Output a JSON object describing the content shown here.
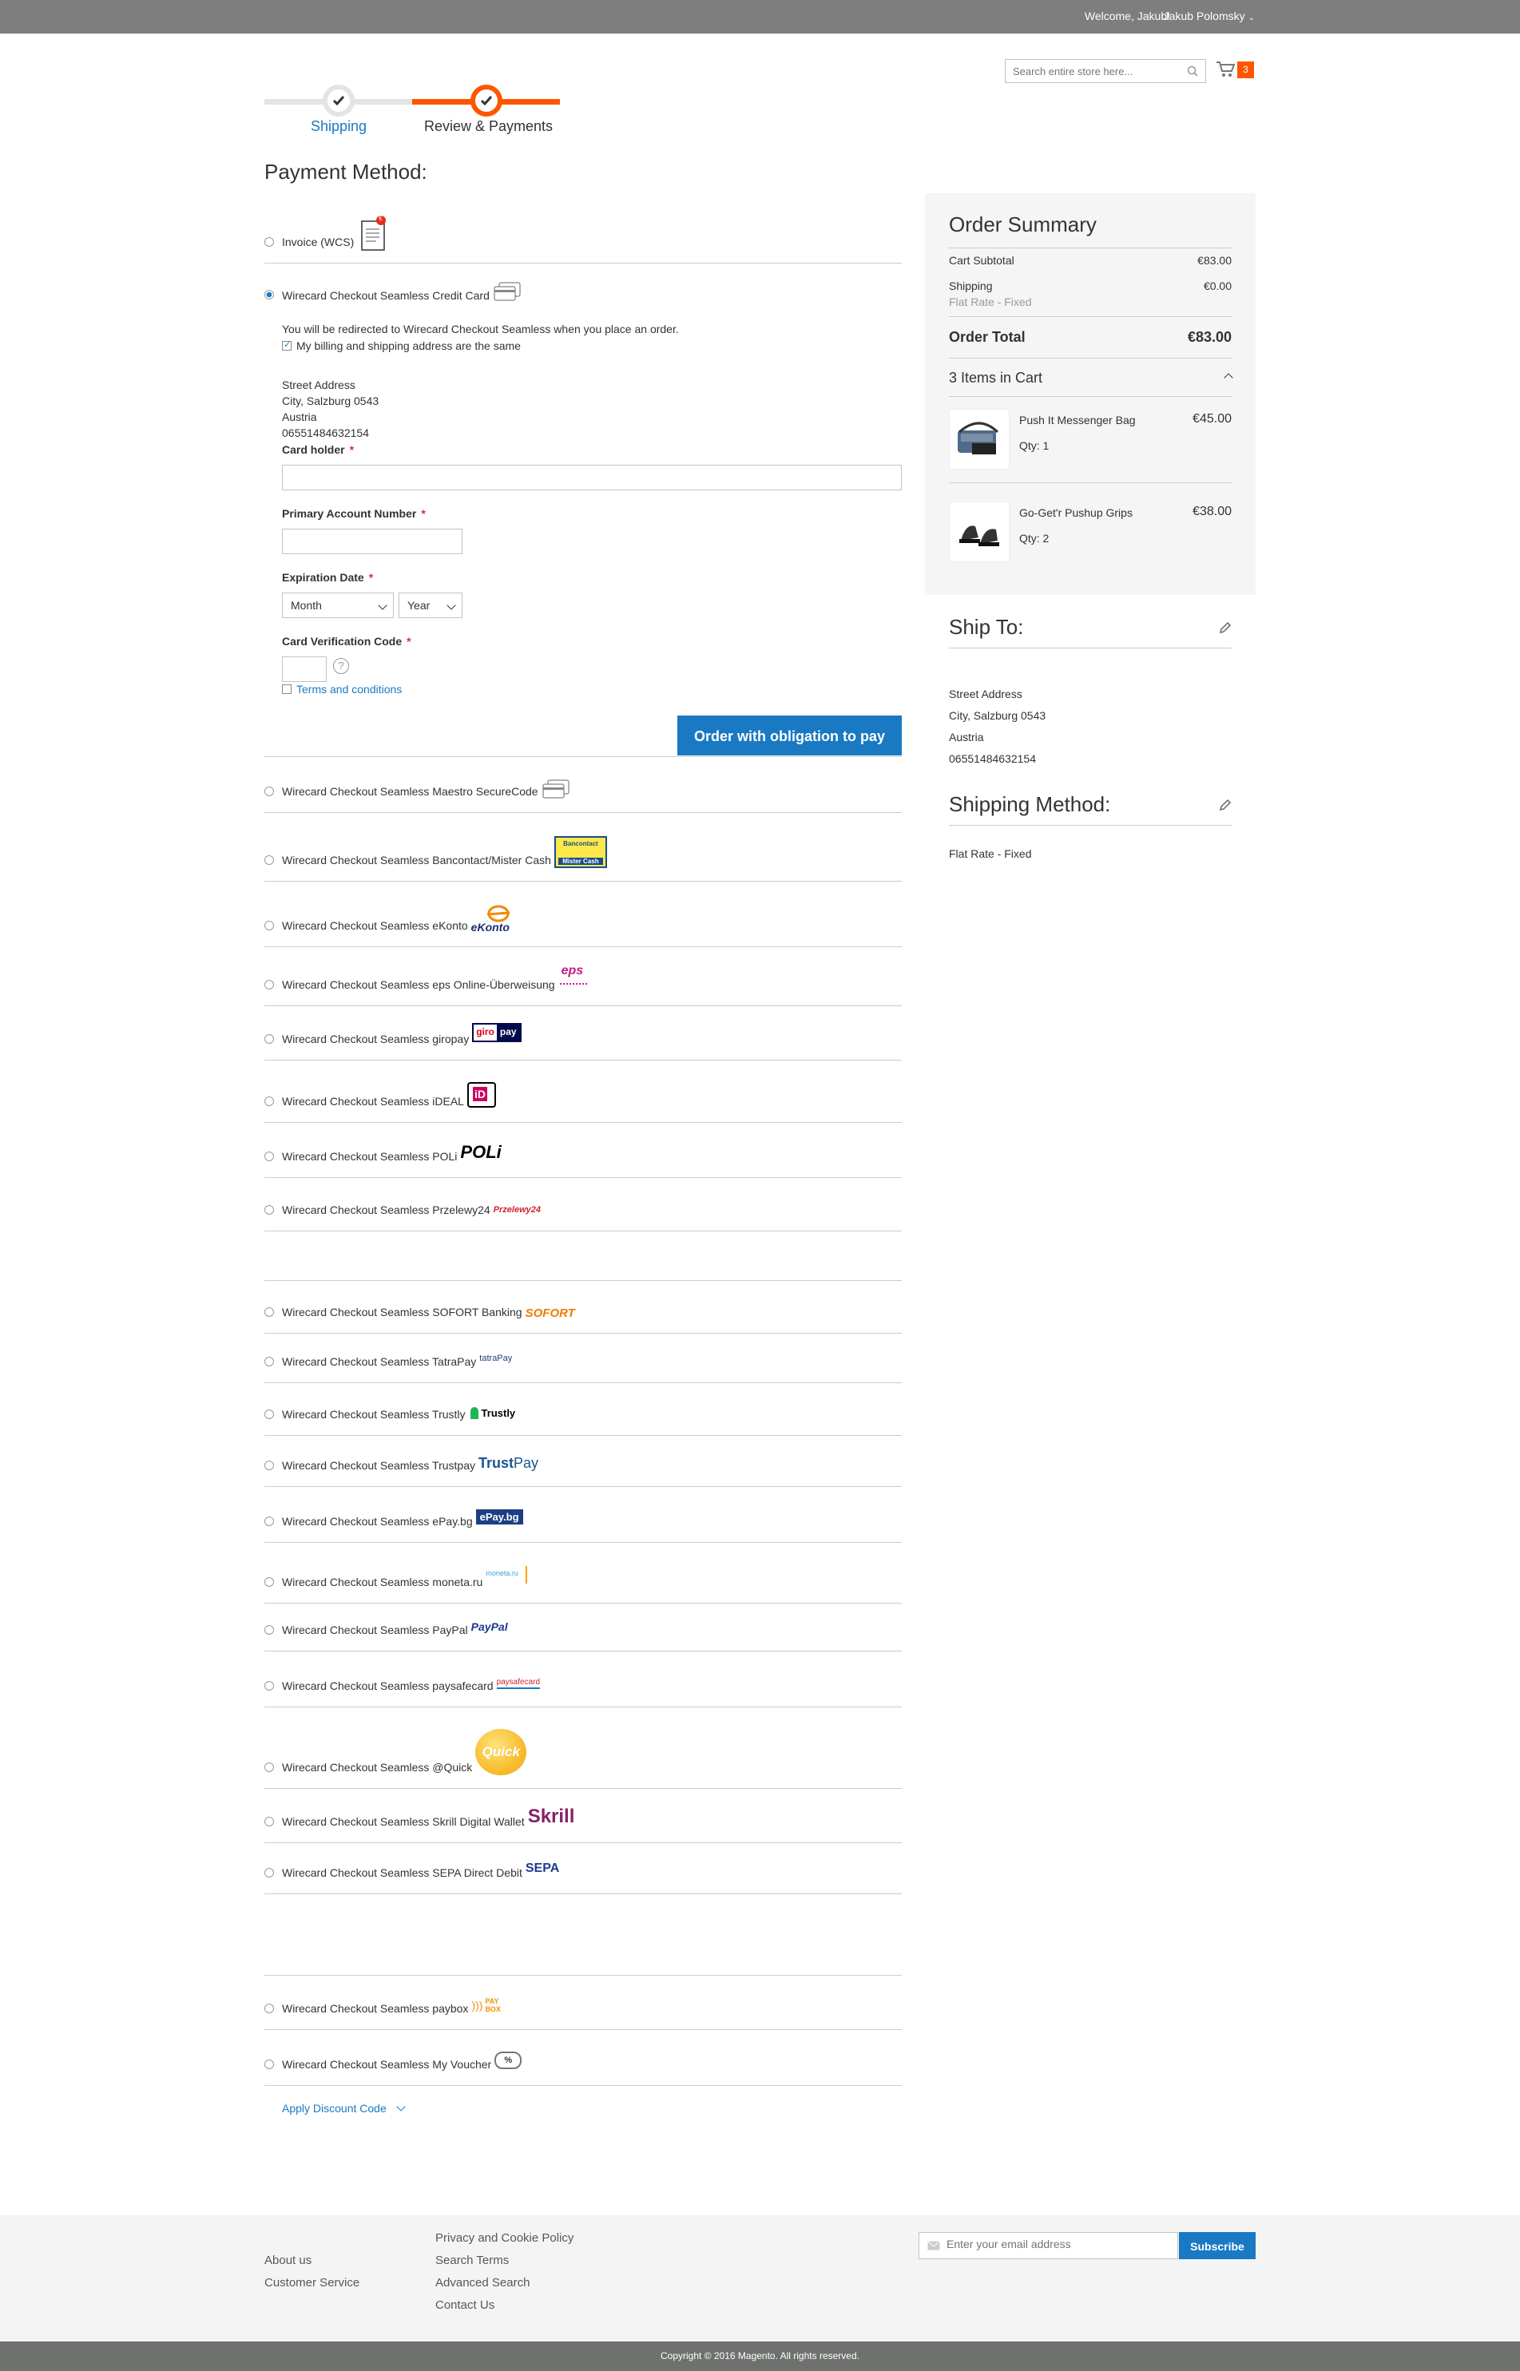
{
  "header": {
    "welcome": "Welcome, Jakub!",
    "user_name": "Jakub Polomsky",
    "search_placeholder": "Search entire store here...",
    "cart_count": "3"
  },
  "progress": {
    "step1": "Shipping",
    "step2": "Review & Payments"
  },
  "payment": {
    "title": "Payment Method:",
    "invoice_label": "Invoice (WCS)",
    "invoice_badge": "€",
    "cc_label": "Wirecard Checkout Seamless Credit Card",
    "redirect_text": "You will be redirected to Wirecard Checkout Seamless when you place an order.",
    "same_address_label": "My billing and shipping address are the same",
    "address": [
      "Street Address",
      "City, Salzburg 0543",
      "Austria",
      "06551484632154"
    ],
    "card_holder_label": "Card holder",
    "pan_label": "Primary Account Number",
    "expiration_label": "Expiration Date",
    "month_selected": "Month",
    "year_selected": "Year",
    "cvc_label": "Card Verification Code",
    "cvc_help": "?",
    "terms_label": "Terms and conditions",
    "order_button": "Order with obligation to pay",
    "discount_label": "Apply Discount Code",
    "methods": [
      {
        "label": "Wirecard Checkout Seamless Maestro SecureCode",
        "logo": "card-icon"
      },
      {
        "label": "Wirecard Checkout Seamless Bancontact/Mister Cash",
        "logo": "bancontact-logo",
        "logo_text_1": "Bancontact",
        "logo_text_2": "Mister Cash"
      },
      {
        "label": "Wirecard Checkout Seamless eKonto",
        "logo": "ekonto-logo",
        "logo_text": "eKonto"
      },
      {
        "label": "Wirecard Checkout Seamless eps Online-Überweisung",
        "logo": "eps-logo",
        "logo_text": "eps"
      },
      {
        "label": "Wirecard Checkout Seamless giropay",
        "logo": "giropay-logo",
        "logo_text_1": "giro",
        "logo_text_2": "pay"
      },
      {
        "label": "Wirecard Checkout Seamless iDEAL",
        "logo": "ideal-logo",
        "logo_text": "iD"
      },
      {
        "label": "Wirecard Checkout Seamless POLi",
        "logo": "poli-logo",
        "logo_text": "POLi"
      },
      {
        "label": "Wirecard Checkout Seamless Przelewy24",
        "logo": "przelewy24-logo",
        "logo_text": "Przelewy24"
      },
      {
        "label": "",
        "logo": ""
      },
      {
        "label": "Wirecard Checkout Seamless SOFORT Banking",
        "logo": "sofort-logo",
        "logo_text": "SOFORT"
      },
      {
        "label": "Wirecard Checkout Seamless TatraPay",
        "logo": "tatrapay-logo",
        "logo_text": "tatraPay"
      },
      {
        "label": "Wirecard Checkout Seamless Trustly",
        "logo": "trustly-logo",
        "logo_text": "Trustly"
      },
      {
        "label": "Wirecard Checkout Seamless Trustpay",
        "logo": "trustpay-logo",
        "logo_text_1": "Trust",
        "logo_text_2": "Pay"
      },
      {
        "label": "Wirecard Checkout Seamless ePay.bg",
        "logo": "epaybg-logo",
        "logo_text": "ePay.bg"
      },
      {
        "label": "Wirecard Checkout Seamless moneta.ru",
        "logo": "moneta-logo",
        "logo_text": "moneta.ru"
      },
      {
        "label": "Wirecard Checkout Seamless PayPal",
        "logo": "paypal-logo",
        "logo_text": "PayPal"
      },
      {
        "label": "Wirecard Checkout Seamless paysafecard",
        "logo": "paysafecard-logo",
        "logo_text": "paysafecard"
      },
      {
        "label": "Wirecard Checkout Seamless @Quick",
        "logo": "quick-logo",
        "logo_text": "Quick"
      },
      {
        "label": "Wirecard Checkout Seamless Skrill Digital Wallet",
        "logo": "skrill-logo",
        "logo_text": "Skrill"
      },
      {
        "label": "Wirecard Checkout Seamless SEPA Direct Debit",
        "logo": "sepa-logo",
        "logo_text": "SEPA"
      },
      {
        "label": "",
        "logo": ""
      },
      {
        "label": "Wirecard Checkout Seamless paybox",
        "logo": "paybox-logo",
        "logo_text_1": "PAY",
        "logo_text_2": "BOX"
      },
      {
        "label": "Wirecard Checkout Seamless My Voucher",
        "logo": "voucher-logo",
        "logo_text": "%"
      }
    ]
  },
  "summary": {
    "title": "Order Summary",
    "cart_subtotal_label": "Cart Subtotal",
    "cart_subtotal": "€83.00",
    "shipping_label": "Shipping",
    "shipping_value": "€0.00",
    "shipping_method": "Flat Rate - Fixed",
    "order_total_label": "Order Total",
    "order_total": "€83.00",
    "items_in_cart": "3 Items in Cart",
    "items": [
      {
        "name": "Push It Messenger Bag",
        "qty": "Qty: 1",
        "price": "€45.00"
      },
      {
        "name": "Go-Get'r Pushup Grips",
        "qty": "Qty: 2",
        "price": "€38.00"
      }
    ]
  },
  "ship_to": {
    "title": "Ship To:",
    "address": [
      "Street Address",
      "City, Salzburg 0543",
      "Austria",
      "06551484632154"
    ],
    "method_title": "Shipping Method:",
    "method": "Flat Rate - Fixed"
  },
  "footer": {
    "about": "About us",
    "customer_service": "Customer Service",
    "privacy": "Privacy and Cookie Policy",
    "search_terms": "Search Terms",
    "advanced_search": "Advanced Search",
    "contact": "Contact Us",
    "email_placeholder": "Enter your email address",
    "subscribe": "Subscribe",
    "copyright": "Copyright © 2016 Magento. All rights reserved."
  },
  "colors": {
    "accent": "#1979c3",
    "brand_orange": "#ff5501",
    "topbar": "#7e7e7e"
  }
}
